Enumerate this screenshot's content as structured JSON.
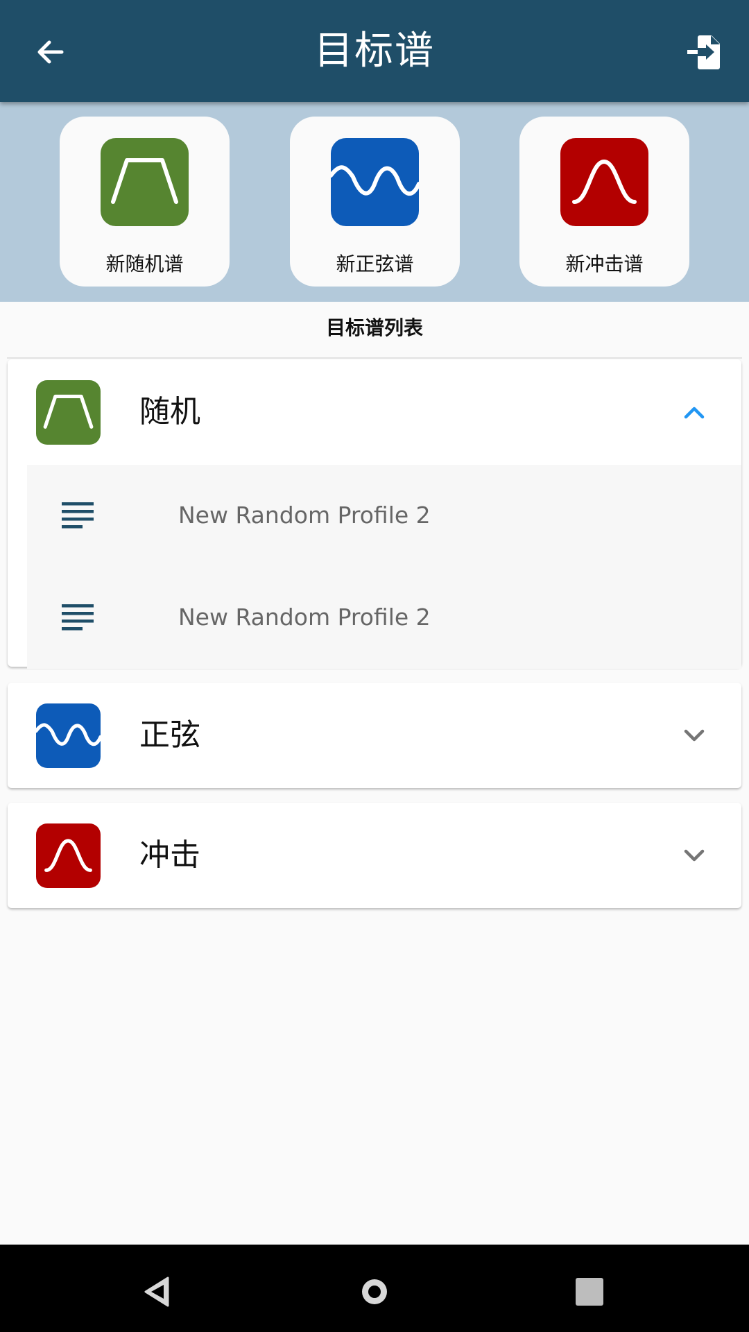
{
  "header": {
    "title": "目标谱",
    "back_icon": "arrow-left-icon",
    "export_icon": "file-export-icon",
    "background": "#1f4e68"
  },
  "create": {
    "background": "#b3c9da",
    "tiles": [
      {
        "label": "新随机谱",
        "icon": "random-profile-icon",
        "color": "#568530"
      },
      {
        "label": "新正弦谱",
        "icon": "sine-profile-icon",
        "color": "#0d5bb8"
      },
      {
        "label": "新冲击谱",
        "icon": "shock-profile-icon",
        "color": "#b30000"
      }
    ]
  },
  "list": {
    "title": "目标谱列表",
    "categories": [
      {
        "label": "随机",
        "icon": "random-profile-icon",
        "color": "#568530",
        "expanded": true,
        "chevron": "chevron-up-icon",
        "chevron_color": "#2196f3",
        "items": [
          {
            "name": "New Random Profile 2",
            "icon": "document-lines-icon"
          },
          {
            "name": "New Random Profile 2",
            "icon": "document-lines-icon"
          }
        ]
      },
      {
        "label": "正弦",
        "icon": "sine-profile-icon",
        "color": "#0d5bb8",
        "expanded": false,
        "chevron": "chevron-down-icon",
        "chevron_color": "#757575",
        "items": []
      },
      {
        "label": "冲击",
        "icon": "shock-profile-icon",
        "color": "#b30000",
        "expanded": false,
        "chevron": "chevron-down-icon",
        "chevron_color": "#757575",
        "items": []
      }
    ]
  },
  "navbar": {
    "buttons": [
      "nav-back-icon",
      "nav-home-icon",
      "nav-recents-icon"
    ]
  }
}
